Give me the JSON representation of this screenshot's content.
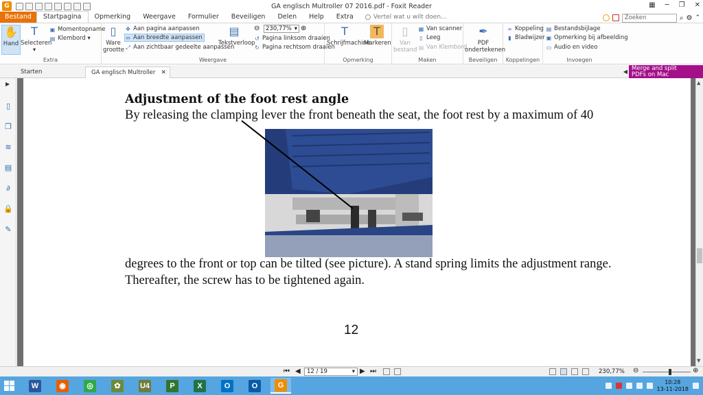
{
  "titlebar": {
    "title": "GA englisch Multroller 07 2016.pdf - Foxit Reader",
    "app_logo": "G"
  },
  "menu": {
    "file": "Bestand",
    "items": [
      "Startpagina",
      "Opmerking",
      "Weergave",
      "Formulier",
      "Beveiligen",
      "Delen",
      "Help",
      "Extra"
    ],
    "tell_me": "Vertel wat u wilt doen...",
    "search_placeholder": "Zoeken"
  },
  "ribbon": {
    "hand": "Hand",
    "select": "Selecteren",
    "snapshot": "Momentopname",
    "clipboard": "Klembord",
    "group_extra": "Extra",
    "actual_size_1": "Ware",
    "actual_size_2": "grootte",
    "fit_page": "Aan pagina aanpassen",
    "fit_width": "Aan breedte aanpassen",
    "fit_visible": "Aan zichtbaar gedeelte aanpassen",
    "reflow": "Tekstverloop",
    "zoom_value": "230,77%",
    "rotate_left": "Pagina linksom draaien",
    "rotate_right": "Pagina rechtsom draaien",
    "group_view": "Weergave",
    "typewriter": "Schrijfmachine",
    "highlight": "Markeren",
    "group_comment": "Opmerking",
    "from_file_1": "Van",
    "from_file_2": "bestand",
    "from_scanner": "Van scanner",
    "blank": "Leeg",
    "from_clipboard": "Van Klembord",
    "group_create": "Maken",
    "pdf_sign_1": "PDF",
    "pdf_sign_2": "ondertekenen",
    "group_protect": "Beveiligen",
    "link": "Koppeling",
    "bookmark": "Bladwijzer",
    "group_links": "Koppelingen",
    "file_attachment": "Bestandsbijlage",
    "image_annotation": "Opmerking bij afbeelding",
    "audio_video": "Audio en video",
    "group_insert": "Invoegen"
  },
  "tabs": {
    "start": "Starten",
    "doc": "GA englisch Multroller 07...",
    "promo_1": "Merge and split",
    "promo_2": "PDFs on Mac"
  },
  "document": {
    "heading": "Adjustment of the foot rest angle",
    "line1": "By releasing the clamping lever the front beneath the seat, the foot rest by a maximum of 40",
    "line2": "degrees to the front or top can be tilted (see picture). A stand spring limits the adjustment range.",
    "line3": "Thereafter, the screw has to be tightened again.",
    "page_number": "12"
  },
  "status": {
    "page_indicator": "12 / 19",
    "zoom": "230,77%"
  },
  "taskbar": {
    "apps": [
      {
        "name": "word",
        "glyph": "W",
        "color": "#2b579a"
      },
      {
        "name": "firefox",
        "glyph": "◉",
        "color": "#e66000"
      },
      {
        "name": "chrome",
        "glyph": "◎",
        "color": "#2ea84a"
      },
      {
        "name": "app-leaf",
        "glyph": "✿",
        "color": "#6c8a3a"
      },
      {
        "name": "u4",
        "glyph": "U4",
        "color": "#6d7d3d"
      },
      {
        "name": "project",
        "glyph": "P",
        "color": "#31752f"
      },
      {
        "name": "excel",
        "glyph": "X",
        "color": "#217346"
      },
      {
        "name": "outlook",
        "glyph": "O",
        "color": "#0072c6"
      },
      {
        "name": "outlook-2",
        "glyph": "O",
        "color": "#0a5aa8"
      },
      {
        "name": "foxit",
        "glyph": "G",
        "color": "#f08c00"
      }
    ],
    "time": "10:28",
    "date": "13-11-2018"
  },
  "colors": {
    "accent": "#e8710a",
    "promo": "#a4108a",
    "taskbar": "#55a5e0"
  }
}
